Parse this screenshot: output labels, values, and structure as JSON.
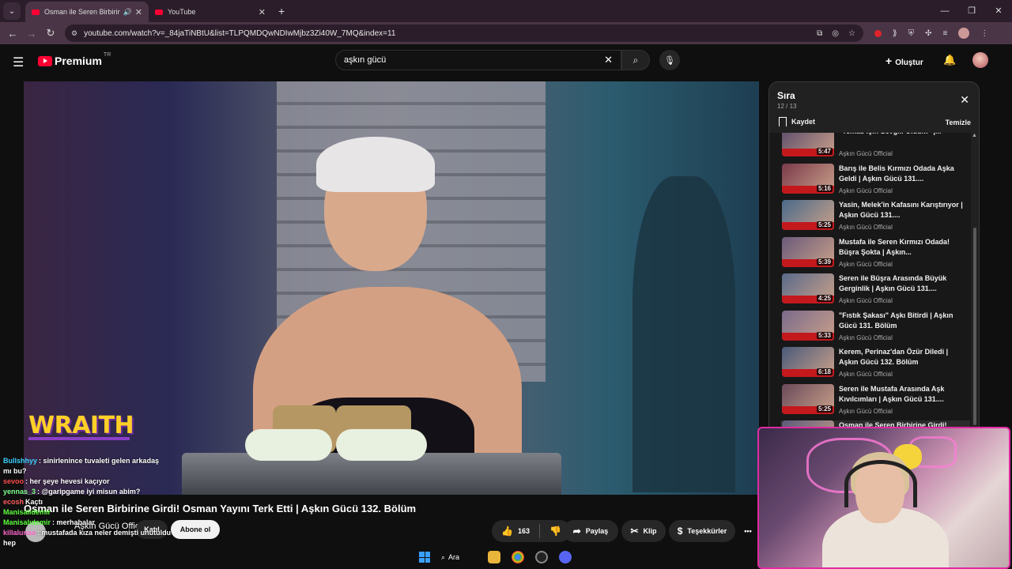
{
  "browser": {
    "tabs": [
      {
        "title": "Osman ile Seren Birbirine Girdi",
        "active": true,
        "audio": true
      },
      {
        "title": "YouTube",
        "active": false,
        "audio": false
      }
    ],
    "new_tab": "+",
    "url": "youtube.com/watch?v=_84jaTiNBtU&list=TLPQMDQwNDIwMjbz3Zi40W_7MQ&index=11"
  },
  "youtube": {
    "logo_text": "Premium",
    "logo_region": "TR",
    "search_value": "aşkın gücü",
    "create_label": "Oluştur",
    "accent": "#ff0033"
  },
  "video": {
    "overlay_brand": "WRAITH",
    "title": "Osman ile Seren Birbirine Girdi! Osman Yayını Terk Etti | Aşkın Gücü 132. Bölüm",
    "channel": "Aşkın Gücü Official",
    "join_label": "Katıl",
    "subscribe_label": "Abone ol",
    "likes": "163",
    "share_label": "Paylaş",
    "clip_label": "Klip",
    "thanks_label": "Teşekkürler",
    "more_label": "•••"
  },
  "chat": [
    {
      "user": "Bullshhyy",
      "color": "#3ad0ff",
      "message": ": sinirlenince tuvaleti gelen arkadaş"
    },
    {
      "user": "",
      "color": "#ffffff",
      "message": "mı bu?"
    },
    {
      "user": "sevoo",
      "color": "#ff4a4a",
      "message": ": her şeye hevesi kaçıyor"
    },
    {
      "user": "yennas_3",
      "color": "#7dff8a",
      "message": ": @garipgame iyi misun abim?"
    },
    {
      "user": "ecosh",
      "color": "#ff5a5a",
      "message": "Kaçtı"
    },
    {
      "user": "Manisalıdemir",
      "color": "#5aff3a",
      "message": ""
    },
    {
      "user": "Manisalıdemir",
      "color": "#5aff3a",
      "message": ": merhabalar"
    },
    {
      "user": "killalunaa",
      "color": "#ff66cc",
      "message": ": mustafada kıza neler demişti unutuldu"
    },
    {
      "user": "",
      "color": "#ffffff",
      "message": "hep"
    }
  ],
  "queue": {
    "title": "Sıra",
    "position": "12 / 13",
    "save_label": "Kaydet",
    "clear_label": "Temizle",
    "items": [
      {
        "title": "\"Temas İçin Sevgili Oldum\" |...",
        "duration": "5:47",
        "channel": "Aşkın Gücü Official"
      },
      {
        "title": "Barış ile Belis Kırmızı Odada Aşka Geldi | Aşkın Gücü 131....",
        "duration": "5:16",
        "channel": "Aşkın Gücü Official"
      },
      {
        "title": "Yasin, Melek'in Kafasını Karıştırıyor | Aşkın Gücü 131....",
        "duration": "5:25",
        "channel": "Aşkın Gücü Official"
      },
      {
        "title": "Mustafa ile Seren Kırmızı Odada! Büşra Şokta | Aşkın...",
        "duration": "5:39",
        "channel": "Aşkın Gücü Official"
      },
      {
        "title": "Seren ile Büşra Arasında Büyük Gerginlik | Aşkın Gücü 131....",
        "duration": "4:25",
        "channel": "Aşkın Gücü Official"
      },
      {
        "title": "\"Fıstık Şakası\" Aşkı Bitirdi | Aşkın Gücü 131. Bölüm",
        "duration": "5:33",
        "channel": "Aşkın Gücü Official"
      },
      {
        "title": "Kerem, Perinaz'dan Özür Diledi | Aşkın Gücü 132. Bölüm",
        "duration": "6:18",
        "channel": "Aşkın Gücü Official"
      },
      {
        "title": "Seren ile Mustafa Arasında Aşk Kıvılcımları | Aşkın Gücü 131....",
        "duration": "5:25",
        "channel": "Aşkın Gücü Official"
      },
      {
        "title": "Osman ile Seren Birbirine Girdi!",
        "duration": "",
        "channel": ""
      }
    ]
  },
  "taskbar": {
    "search_label": "Ara"
  }
}
